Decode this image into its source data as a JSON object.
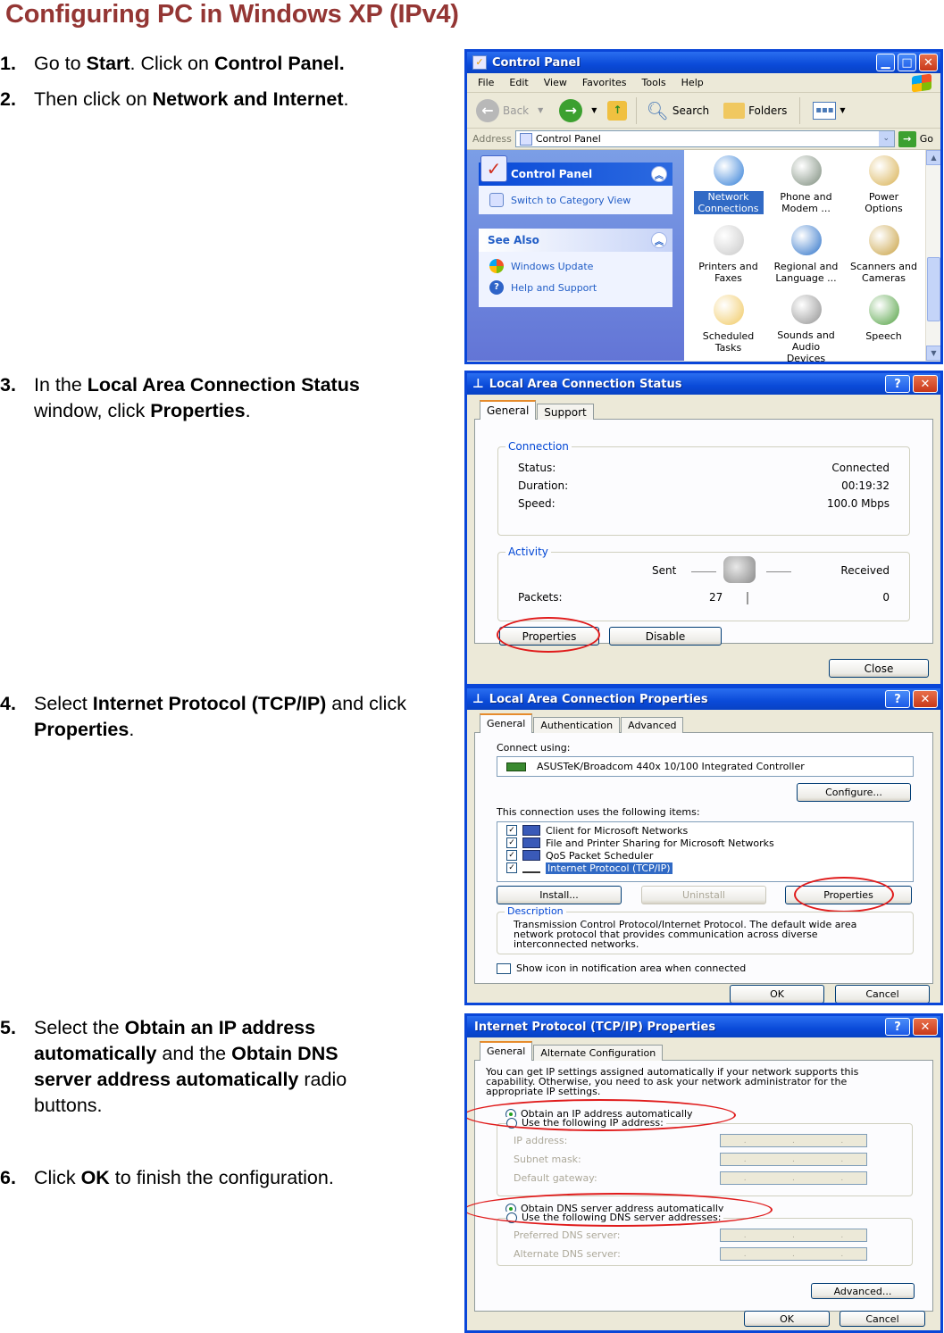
{
  "title": "Configuring PC in Windows XP (IPv4)",
  "colors": {
    "title": "#943634",
    "xp_blue": "#0a46d8",
    "annotation_ring": "#e01b1b",
    "selection": "#316ac5"
  },
  "steps": [
    {
      "num": "1.",
      "parts": [
        {
          "t": "Go to "
        },
        {
          "b": "Start"
        },
        {
          "t": ". Click on "
        },
        {
          "b": "Control Panel."
        }
      ]
    },
    {
      "num": "2.",
      "parts": [
        {
          "t": "Then click on "
        },
        {
          "b": "Network and Internet"
        },
        {
          "t": "."
        }
      ]
    },
    {
      "num": "3.",
      "parts": [
        {
          "t": "In the "
        },
        {
          "b": "Local Area Connection Status"
        },
        {
          "t": " window, click "
        },
        {
          "b": "Properties"
        },
        {
          "t": "."
        }
      ]
    },
    {
      "num": "4.",
      "parts": [
        {
          "t": "Select "
        },
        {
          "b": "Internet Protocol (TCP/IP)"
        },
        {
          "t": " and click "
        },
        {
          "b": "Properties"
        },
        {
          "t": "."
        }
      ]
    },
    {
      "num": "5.",
      "parts": [
        {
          "t": "Select the "
        },
        {
          "b": "Obtain an IP address automatically"
        },
        {
          "t": " and the "
        },
        {
          "b": "Obtain DNS server address automatically"
        },
        {
          "t": " radio buttons."
        }
      ]
    },
    {
      "num": "6.",
      "parts": [
        {
          "t": "Click "
        },
        {
          "b": "OK"
        },
        {
          "t": " to finish the configuration."
        }
      ]
    }
  ],
  "control_panel": {
    "title": "Control Panel",
    "menu": [
      "File",
      "Edit",
      "View",
      "Favorites",
      "Tools",
      "Help"
    ],
    "toolbar": {
      "back": "Back",
      "search": "Search",
      "folders": "Folders"
    },
    "address_label": "Address",
    "address_value": "Control Panel",
    "go": "Go",
    "left_panel": {
      "header": "Control Panel",
      "switch": "Switch to Category View",
      "see_also": "See Also",
      "links": [
        "Windows Update",
        "Help and Support"
      ]
    },
    "items": [
      {
        "label": "Network Connections",
        "selected": true,
        "icon": "network-globe-icon"
      },
      {
        "label": "Phone and Modem ...",
        "icon": "phone-modem-icon"
      },
      {
        "label": "Power Options",
        "icon": "power-plug-icon"
      },
      {
        "label": "Printers and Faxes",
        "icon": "printer-icon"
      },
      {
        "label": "Regional and Language ...",
        "icon": "globe-icon"
      },
      {
        "label": "Scanners and Cameras",
        "icon": "camera-icon"
      },
      {
        "label": "Scheduled Tasks",
        "icon": "scheduled-folder-icon"
      },
      {
        "label": "Sounds and Audio Devices",
        "icon": "speaker-icon"
      },
      {
        "label": "Speech",
        "icon": "speech-person-icon"
      }
    ]
  },
  "status_dialog": {
    "title": "Local Area Connection Status",
    "tabs": [
      "General",
      "Support"
    ],
    "connection_group": "Connection",
    "status_label": "Status:",
    "status_value": "Connected",
    "duration_label": "Duration:",
    "duration_value": "00:19:32",
    "speed_label": "Speed:",
    "speed_value": "100.0 Mbps",
    "activity_group": "Activity",
    "sent_label": "Sent",
    "received_label": "Received",
    "packets_label": "Packets:",
    "packets_sent": "27",
    "packets_received": "0",
    "properties": "Properties",
    "disable": "Disable",
    "close": "Close"
  },
  "props_dialog": {
    "title": "Local Area Connection Properties",
    "tabs": [
      "General",
      "Authentication",
      "Advanced"
    ],
    "connect_using_label": "Connect using:",
    "adapter": "ASUSTeK/Broadcom 440x 10/100 Integrated Controller",
    "configure": "Configure...",
    "items_label": "This connection uses the following items:",
    "items": [
      {
        "label": "Client for Microsoft Networks",
        "checked": true
      },
      {
        "label": "File and Printer Sharing for Microsoft Networks",
        "checked": true
      },
      {
        "label": "QoS Packet Scheduler",
        "checked": true
      },
      {
        "label": "Internet Protocol (TCP/IP)",
        "checked": true,
        "selected": true
      }
    ],
    "install": "Install...",
    "uninstall": "Uninstall",
    "properties": "Properties",
    "description_group": "Description",
    "description": "Transmission Control Protocol/Internet Protocol. The default wide area network protocol that provides communication across diverse interconnected networks.",
    "show_icon": "Show icon in notification area when connected",
    "show_icon_checked": false,
    "ok": "OK",
    "cancel": "Cancel"
  },
  "tcpip_dialog": {
    "title": "Internet Protocol (TCP/IP) Properties",
    "tabs": [
      "General",
      "Alternate Configuration"
    ],
    "intro": "You can get IP settings assigned automatically if your network supports this capability. Otherwise, you need to ask your network administrator for the appropriate IP settings.",
    "obtain_ip": "Obtain an IP address automatically",
    "use_ip": "Use the following IP address:",
    "ip_label": "IP address:",
    "subnet_label": "Subnet mask:",
    "gateway_label": "Default gateway:",
    "obtain_dns": "Obtain DNS server address automatically",
    "use_dns": "Use the following DNS server addresses:",
    "preferred_dns": "Preferred DNS server:",
    "alternate_dns": "Alternate DNS server:",
    "advanced": "Advanced...",
    "ok": "OK",
    "cancel": "Cancel",
    "obtain_ip_selected": true,
    "obtain_dns_selected": true
  }
}
